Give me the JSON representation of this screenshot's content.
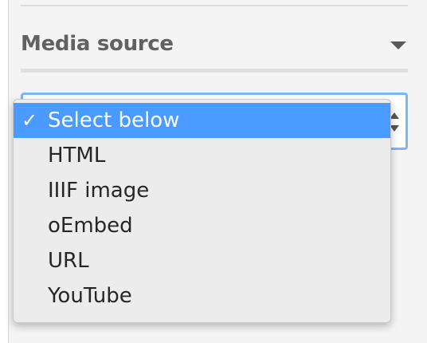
{
  "sidebar": {
    "section_title": "Media source",
    "section_toggle_icon": "caret-down-icon"
  },
  "media_source_select": {
    "selected_value": "Select below",
    "options": [
      {
        "label": "Select below",
        "selected": true
      },
      {
        "label": "HTML",
        "selected": false
      },
      {
        "label": "IIIF image",
        "selected": false
      },
      {
        "label": "oEmbed",
        "selected": false
      },
      {
        "label": "URL",
        "selected": false
      },
      {
        "label": "YouTube",
        "selected": false
      }
    ]
  },
  "colors": {
    "highlight": "#4a9bff",
    "focus_ring": "#7eb5f3",
    "header_text": "#616161"
  }
}
